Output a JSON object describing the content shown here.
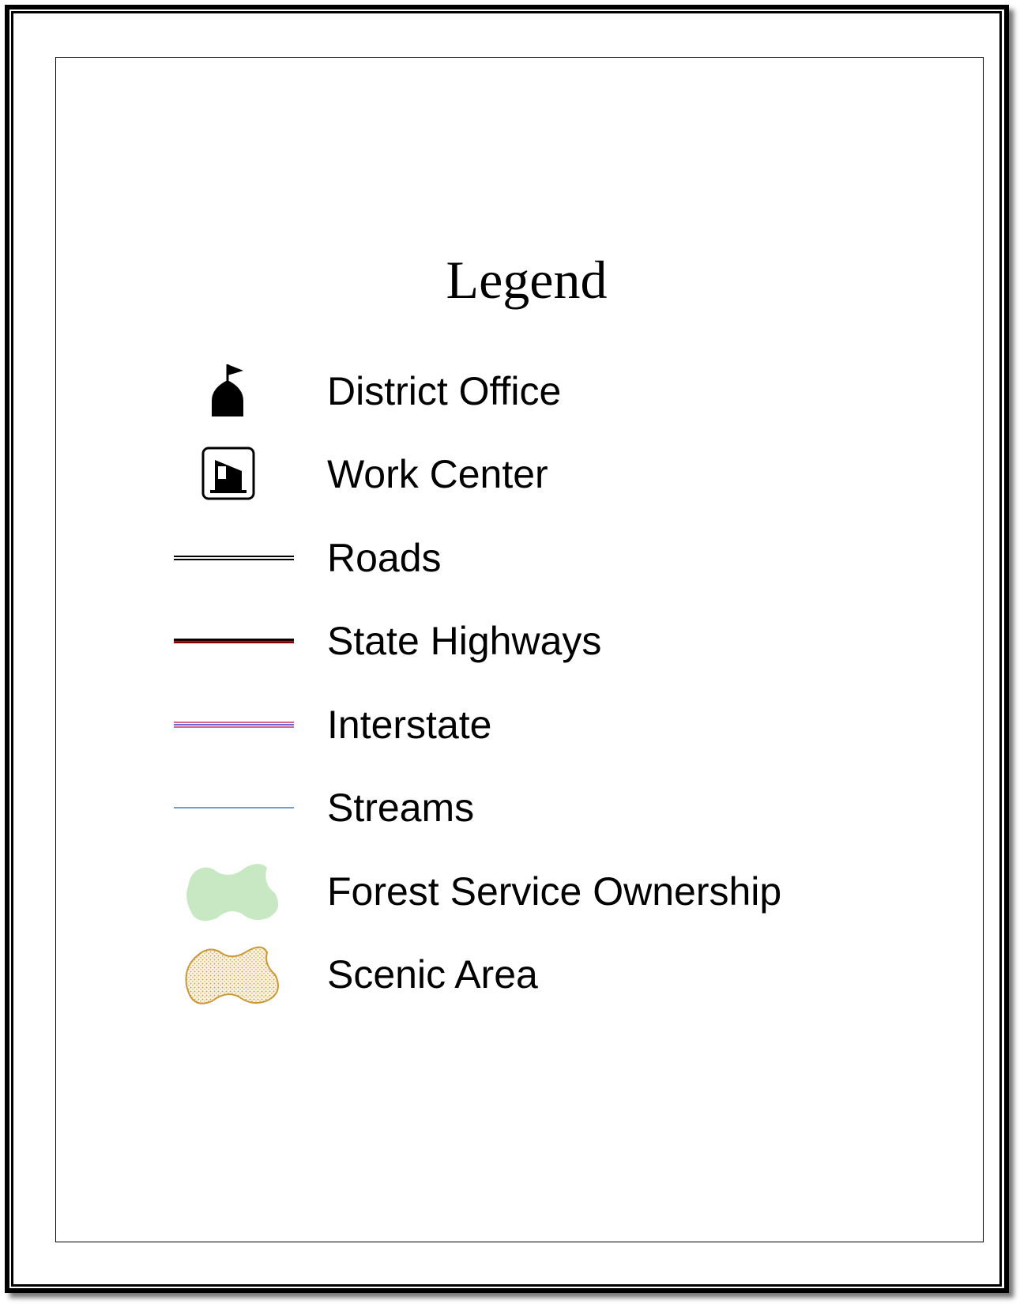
{
  "legend": {
    "title": "Legend",
    "items": [
      {
        "label": "District Office",
        "symbol": "district-office-icon"
      },
      {
        "label": "Work Center",
        "symbol": "work-center-icon"
      },
      {
        "label": "Roads",
        "symbol": "road-line",
        "colors": [
          "#000000",
          "#ffffff"
        ]
      },
      {
        "label": "State Highways",
        "symbol": "state-highway-line",
        "colors": [
          "#000000",
          "#cc0000"
        ]
      },
      {
        "label": "Interstate",
        "symbol": "interstate-line",
        "colors": [
          "#3333cc",
          "#cc3333"
        ]
      },
      {
        "label": "Streams",
        "symbol": "stream-line",
        "colors": [
          "#3a7fc4"
        ]
      },
      {
        "label": "Forest Service Ownership",
        "symbol": "forest-service-area",
        "colors": [
          "#c8e8c4"
        ]
      },
      {
        "label": "Scenic Area",
        "symbol": "scenic-area",
        "colors": [
          "#c89a3a",
          "#f3e2b8"
        ]
      }
    ]
  }
}
